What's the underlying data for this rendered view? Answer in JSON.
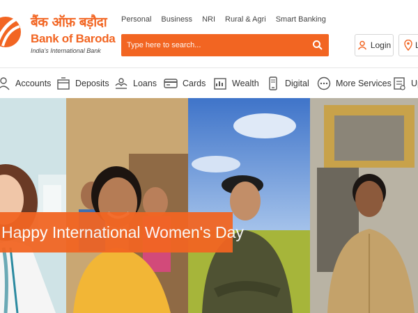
{
  "brand": {
    "hindi_name": "बैंक ऑफ़ बड़ौदा",
    "name": "Bank of Baroda",
    "tagline": "India's International Bank",
    "color": "#f26522"
  },
  "top_nav": [
    "Personal",
    "Business",
    "NRI",
    "Rural & Agri",
    "Smart Banking"
  ],
  "search": {
    "placeholder": "Type here to search...",
    "icon": "search-icon"
  },
  "login": {
    "label": "Login",
    "icon": "user-icon"
  },
  "locate": {
    "label": "L",
    "icon": "location-pin-icon"
  },
  "main_nav": [
    {
      "label": "Accounts",
      "icon": "accounts-icon"
    },
    {
      "label": "Deposits",
      "icon": "deposits-icon"
    },
    {
      "label": "Loans",
      "icon": "loans-icon"
    },
    {
      "label": "Cards",
      "icon": "card-icon"
    },
    {
      "label": "Wealth",
      "icon": "wealth-icon"
    },
    {
      "label": "Digital",
      "icon": "digital-icon"
    },
    {
      "label": "More Services",
      "icon": "more-icon"
    },
    {
      "label": "Up",
      "icon": "updates-icon"
    }
  ],
  "banner": {
    "title": "Happy International Women's Day"
  }
}
